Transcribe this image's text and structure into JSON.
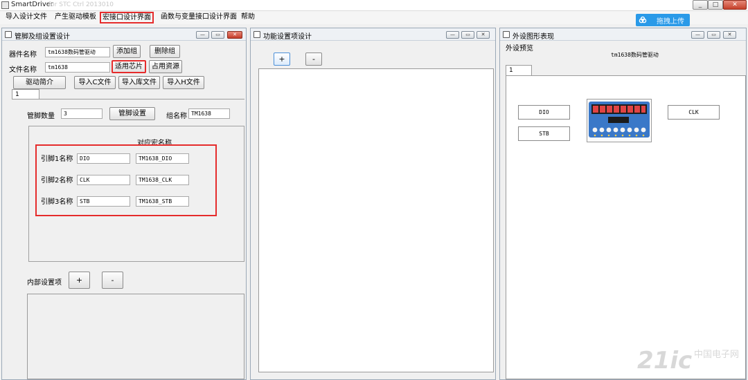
{
  "window": {
    "title": "SmartDriver",
    "subtitle": "for STC Ctrl 2013010",
    "min": "_",
    "max": "□",
    "close": "✕"
  },
  "menu": [
    "导入设计文件",
    "产生驱动模板",
    "宏接口设计界面",
    "函数与变量接口设计界面",
    "帮助"
  ],
  "upload": {
    "label": "拖拽上传",
    "icon": "cloud-icon"
  },
  "panel_btns": {
    "min": "—",
    "max": "▭",
    "close": "✕"
  },
  "left_panel": {
    "title": "管脚及组设置设计",
    "device_name_label": "器件名称",
    "device_name_value": "tm1638数码管驱动",
    "add_group": "添加组",
    "delete_group": "删除组",
    "file_name_label": "文件名称",
    "file_name_value": "tm1638",
    "apply_chip": "适用芯片",
    "use_resources": "占用资源",
    "driver_intro": "驱动简介",
    "import_c": "导入C文件",
    "import_lib": "导入库文件",
    "import_h": "导入H文件",
    "tab": "1",
    "pin_count_label": "管脚数量",
    "pin_count_value": "3",
    "pin_settings": "管脚设置",
    "group_name_label": "组名称",
    "group_name_value": "TM1638",
    "macro_header": "对应宏名称",
    "pins": [
      {
        "label": "引脚1名称",
        "name": "DIO",
        "macro": "TM1638_DIO"
      },
      {
        "label": "引脚2名称",
        "name": "CLK",
        "macro": "TM1638_CLK"
      },
      {
        "label": "引脚3名称",
        "name": "STB",
        "macro": "TM1638_STB"
      }
    ],
    "internal_label": "内部设置项",
    "plus": "+",
    "minus": "-"
  },
  "mid_panel": {
    "title": "功能设置项设计",
    "plus": "+",
    "minus": "-"
  },
  "right_panel": {
    "title": "外设图形表现",
    "preview_label": "外设预览",
    "preview_title": "tm1638数码管驱动",
    "tab": "1",
    "pin_dio": "DIO",
    "pin_stb": "STB",
    "pin_clk": "CLK"
  },
  "watermark": {
    "text": "21ic",
    "cn": "中国电子网"
  },
  "colors": {
    "accent_red": "#e52b2b",
    "upload_blue": "#2a9ae8"
  }
}
